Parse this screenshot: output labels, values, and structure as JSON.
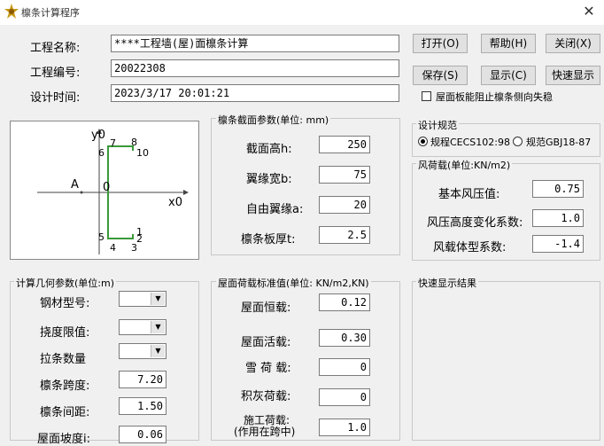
{
  "window": {
    "title": "檩条计算程序",
    "close_glyph": "✕"
  },
  "project": {
    "name_label": "工程名称:",
    "name_value": "****工程墙(屋)面檩条计算",
    "code_label": "工程编号:",
    "code_value": "20022308",
    "time_label": "设计时间:",
    "time_value": "2023/3/17 20:01:21"
  },
  "buttons": {
    "open": "打开(O)",
    "help": "帮助(H)",
    "close": "关闭(X)",
    "save": "保存(S)",
    "display": "显示(C)",
    "quick_display": "快速显示"
  },
  "roof_check_label": "屋面板能阻止檩条侧向失稳",
  "diagram": {
    "axis_y": "y0",
    "axis_x": "x0",
    "label_A": "A",
    "origin": "0",
    "pts": [
      "1",
      "2",
      "3",
      "4",
      "5",
      "6",
      "7",
      "8",
      "10"
    ]
  },
  "section": {
    "title": "檩条截面参数(单位: mm)",
    "h_label": "截面高h:",
    "h_value": "250",
    "b_label": "翼缘宽b:",
    "b_value": "75",
    "a_label": "自由翼缘a:",
    "a_value": "20",
    "t_label": "檩条板厚t:",
    "t_value": "2.5"
  },
  "code": {
    "title": "设计规范",
    "opt1": "规程CECS102:98",
    "opt2": "规范GBJ18-87",
    "selected": "opt1"
  },
  "wind": {
    "title": "风荷载(单位:KN/m2)",
    "basic_label": "基本风压值:",
    "basic_value": "0.75",
    "height_label": "风压高度变化系数:",
    "height_value": "1.0",
    "shape_label": "风载体型系数:",
    "shape_value": "-1.4"
  },
  "geom": {
    "title": "计算几何参数(单位:m)",
    "steel_label": "钢材型号:",
    "defl_label": "挠度限值:",
    "tie_label": "拉条数量",
    "span_label": "檩条跨度:",
    "span_value": "7.20",
    "spacing_label": "檩条间距:",
    "spacing_value": "1.50",
    "slope_label": "屋面坡度i:",
    "slope_value": "0.06"
  },
  "loads": {
    "title": "屋面荷载标准值(单位: KN/m2,KN)",
    "dead_label": "屋面恒载:",
    "dead_value": "0.12",
    "live_label": "屋面活载:",
    "live_value": "0.30",
    "snow_label": "雪 荷 载:",
    "snow_value": "0",
    "ash_label": "积灰荷载:",
    "ash_value": "0",
    "const_label1": "施工荷载:",
    "const_label2": "(作用在跨中)",
    "const_value": "1.0"
  },
  "quick": {
    "title": "快速显示结果"
  }
}
